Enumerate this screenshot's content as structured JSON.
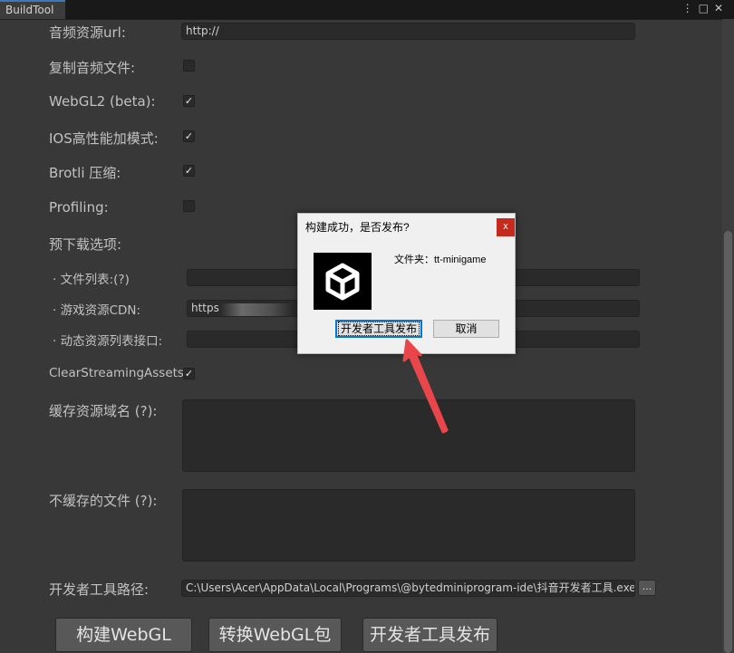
{
  "window": {
    "tab_title": "BuildTool",
    "icons": [
      "menu-icon",
      "maximize-icon",
      "close-icon"
    ]
  },
  "form": {
    "audio_url": {
      "label": "音频资源url:",
      "value": "http://"
    },
    "copy_audio": {
      "label": "复制音频文件:",
      "checked": false
    },
    "webgl2": {
      "label": "WebGL2 (beta):",
      "checked": true
    },
    "ios_high_perf": {
      "label": "IOS高性能加模式:",
      "checked": true
    },
    "brotli": {
      "label": "Brotli 压缩:",
      "checked": true
    },
    "profiling": {
      "label": "Profiling:",
      "checked": false
    },
    "preload_section": {
      "label": "预下载选项:"
    },
    "file_list": {
      "label": "· 文件列表:(?)",
      "value": ""
    },
    "cdn": {
      "label": "· 游戏资源CDN:",
      "value": "https://"
    },
    "dynamic_list": {
      "label": "· 动态资源列表接口:",
      "value": ""
    },
    "clear_streaming": {
      "label": "ClearStreamingAssets:",
      "checked": true
    },
    "cache_domain": {
      "label": "缓存资源域名 (?):",
      "value": ""
    },
    "no_cache_files": {
      "label": "不缓存的文件 (?):",
      "value": ""
    },
    "devtool_path": {
      "label": "开发者工具路径:",
      "value": "C:\\Users\\Acer\\AppData\\Local\\Programs\\@bytedminiprogram-ide\\抖音开发者工具.exe",
      "browse_label": "..."
    }
  },
  "actions": {
    "build_webgl": "构建WebGL",
    "convert_webgl": "转换WebGL包",
    "publish_devtool": "开发者工具发布"
  },
  "dialog": {
    "title": "构建成功，是否发布?",
    "close": "x",
    "message": "文件夹：tt-minigame",
    "primary_button": "开发者工具发布",
    "cancel_button": "取消"
  },
  "colors": {
    "background": "#383838",
    "annotation_arrow": "#e8464a",
    "accent": "#3a79bb"
  }
}
